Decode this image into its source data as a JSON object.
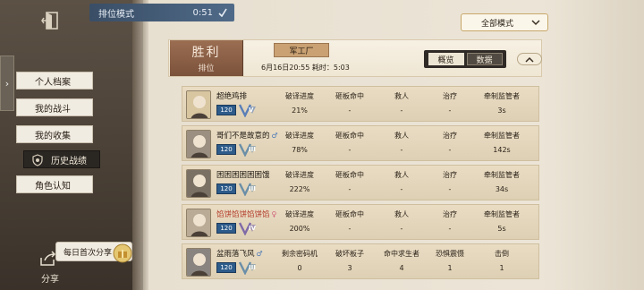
{
  "top": {
    "mode_label": "排位模式",
    "timer": "0:51"
  },
  "nav": {
    "items": [
      {
        "label": "个人档案"
      },
      {
        "label": "我的战斗"
      },
      {
        "label": "我的收集"
      },
      {
        "label": "历史战绩"
      },
      {
        "label": "角色认知"
      }
    ],
    "active_index": 3
  },
  "share": {
    "daily_tag": "每日首次分享",
    "label": "分享"
  },
  "filter": {
    "selected": "全部模式"
  },
  "match": {
    "result": "胜利",
    "mode": "排位",
    "map": "军工厂",
    "meta": "6月16日20:55  耗时：5:03",
    "tabs": [
      {
        "label": "概览"
      },
      {
        "label": "数据"
      }
    ],
    "selected_tab": 1
  },
  "players": [
    {
      "name": "超绝鸡排",
      "name_color": "normal",
      "gender": "",
      "level": "120",
      "rank": "V",
      "headers": [
        "破译进度",
        "砸板命中",
        "救人",
        "治疗",
        "牵制监管者"
      ],
      "values": [
        "21%",
        "-",
        "-",
        "-",
        "3s"
      ]
    },
    {
      "name": "哥们不是故意的",
      "name_color": "normal",
      "gender": "♂",
      "level": "120",
      "rank": "III",
      "headers": [
        "破译进度",
        "砸板命中",
        "救人",
        "治疗",
        "牵制监管者"
      ],
      "values": [
        "78%",
        "-",
        "-",
        "-",
        "142s"
      ]
    },
    {
      "name": "困困困困困困饿",
      "name_color": "normal",
      "gender": "",
      "level": "120",
      "rank": "III",
      "headers": [
        "破译进度",
        "砸板命中",
        "救人",
        "治疗",
        "牵制监管者"
      ],
      "values": [
        "222%",
        "-",
        "-",
        "-",
        "34s"
      ]
    },
    {
      "name": "馅饼馅饼馅饼馅",
      "name_color": "red",
      "gender": "♀",
      "level": "120",
      "rank": "IV",
      "headers": [
        "破译进度",
        "砸板命中",
        "救人",
        "治疗",
        "牵制监管者"
      ],
      "values": [
        "200%",
        "-",
        "-",
        "-",
        "5s"
      ]
    },
    {
      "name": "盆雨落飞风",
      "name_color": "normal",
      "gender": "♂",
      "level": "120",
      "rank": "III",
      "headers": [
        "剩余密码机",
        "破坏板子",
        "命中求生者",
        "恐惧震慑",
        "击倒"
      ],
      "values": [
        "0",
        "3",
        "4",
        "1",
        "1"
      ]
    }
  ],
  "colors": {
    "win_badge": "#8a5e45",
    "level_badge": "#2d5b8a",
    "red_name": "#b33b2a"
  }
}
